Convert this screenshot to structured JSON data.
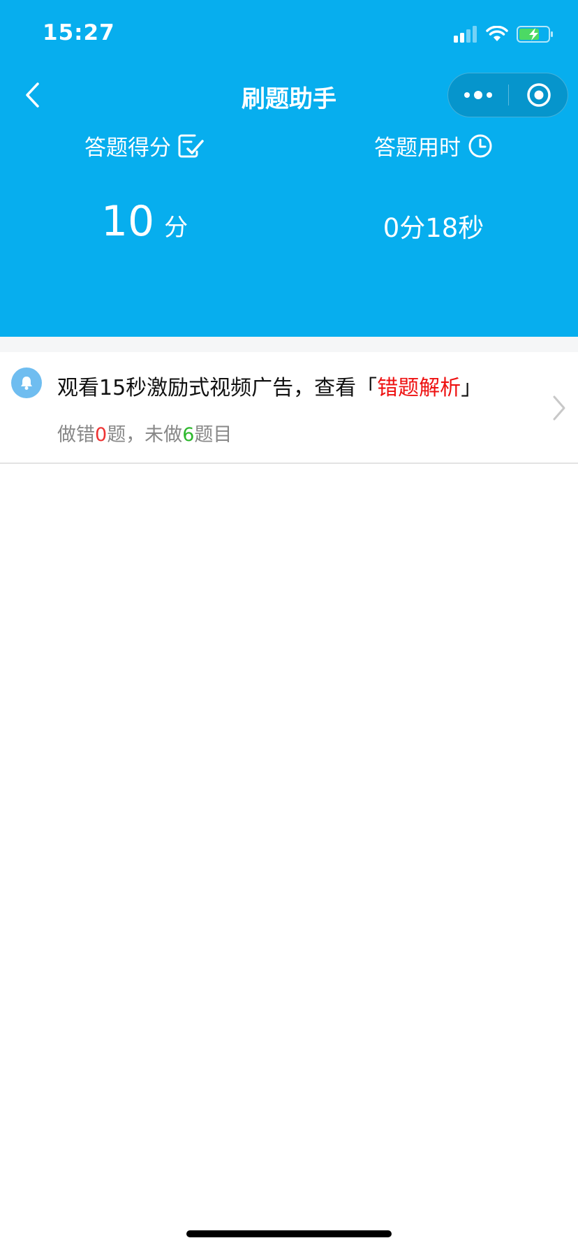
{
  "status_bar": {
    "time": "15:27",
    "icons": [
      "cellular-signal-icon",
      "wifi-icon",
      "battery-charging-icon"
    ]
  },
  "nav": {
    "title": "刷题助手",
    "back_icon": "chevron-left-icon",
    "more_icon": "more-dots-icon",
    "close_icon": "target-close-icon"
  },
  "stats": {
    "score": {
      "label": "答题得分",
      "icon": "edit-check-icon",
      "value": "10",
      "unit": "分"
    },
    "time": {
      "label": "答题用时",
      "icon": "clock-icon",
      "value": "0分18秒"
    }
  },
  "notice": {
    "icon": "bell-icon",
    "title_prefix": "观看15秒激励式视频广告，查看「",
    "title_highlight": "错题解析",
    "title_suffix": "」",
    "sub_prefix": "做错",
    "wrong_count": "0",
    "sub_middle": "题，未做",
    "undone_count": "6",
    "sub_suffix": "题目"
  },
  "colors": {
    "header_bg": "#07AEEE",
    "highlight_red": "#EE1111",
    "undone_green": "#2DB82D",
    "bell_bg": "#6FBDF0"
  }
}
